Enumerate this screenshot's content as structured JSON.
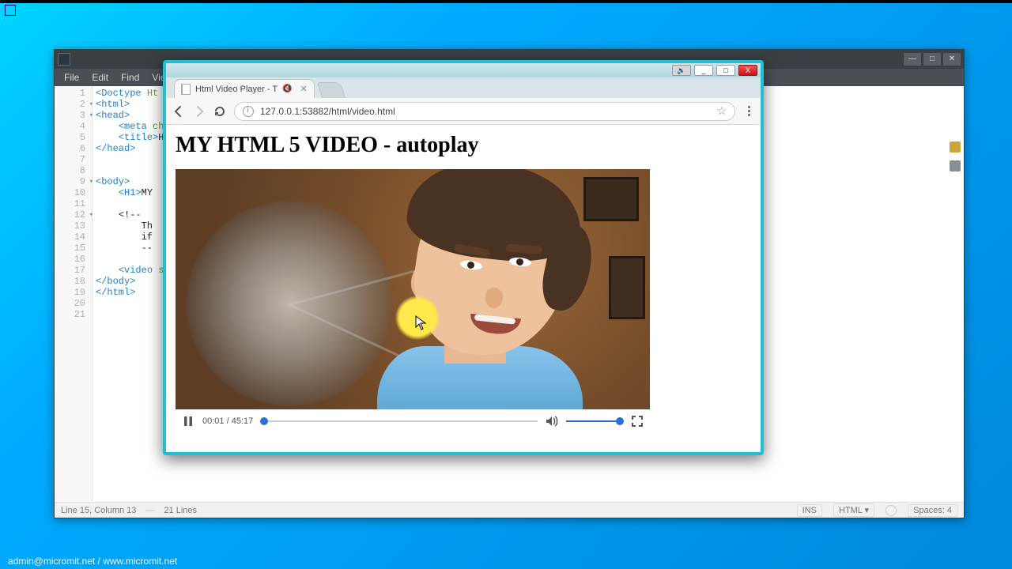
{
  "editor": {
    "menus": [
      "File",
      "Edit",
      "Find",
      "View"
    ],
    "lines": {
      "total": 21,
      "code": [
        {
          "n": 1,
          "html": "<span class='tag'>&lt;Doctype</span> <span class='attr'>Ht</span>"
        },
        {
          "n": 2,
          "fold": true,
          "html": "<span class='tag'>&lt;html&gt;</span>"
        },
        {
          "n": 3,
          "fold": true,
          "html": "<span class='tag'>&lt;head&gt;</span>"
        },
        {
          "n": 4,
          "html": "    <span class='tag'>&lt;meta</span> <span class='attr'>cha</span>"
        },
        {
          "n": 5,
          "html": "    <span class='tag'>&lt;title&gt;</span><span class='txt'>Ht</span>"
        },
        {
          "n": 6,
          "html": "<span class='tag'>&lt;/head&gt;</span>"
        },
        {
          "n": 7,
          "html": ""
        },
        {
          "n": 8,
          "html": ""
        },
        {
          "n": 9,
          "fold": true,
          "html": "<span class='tag'>&lt;body&gt;</span>"
        },
        {
          "n": 10,
          "html": "    <span class='tag'>&lt;H1&gt;</span><span class='txt'>MY</span>"
        },
        {
          "n": 11,
          "html": ""
        },
        {
          "n": 12,
          "fold": true,
          "html": "    <span class='txt'>&lt;!--</span>"
        },
        {
          "n": 13,
          "html": "        <span class='txt'>Th</span>"
        },
        {
          "n": 14,
          "html": "        <span class='txt'>if</span>"
        },
        {
          "n": 15,
          "html": "        <span class='txt'>--</span>"
        },
        {
          "n": 16,
          "html": ""
        },
        {
          "n": 17,
          "html": "    <span class='tag'>&lt;video</span> <span class='attr'>s</span>"
        },
        {
          "n": 18,
          "html": "<span class='tag'>&lt;/body&gt;</span>"
        },
        {
          "n": 19,
          "html": "<span class='tag'>&lt;/html&gt;</span>"
        },
        {
          "n": 20,
          "html": ""
        },
        {
          "n": 21,
          "html": ""
        }
      ]
    },
    "status": {
      "pos": "Line 15, Column 13",
      "lines": "21 Lines",
      "ins": "INS",
      "lang": "HTML",
      "spaces": "Spaces: 4"
    },
    "winctrls": {
      "min": "—",
      "max": "□",
      "close": "✕"
    }
  },
  "browser": {
    "winbuttons": {
      "mute": "🔇",
      "min": "_",
      "max": "□",
      "close": "X"
    },
    "tab": {
      "title": "Html Video Player - T",
      "muted": true
    },
    "nav": {
      "back": "",
      "forward": "",
      "reload": ""
    },
    "url": "127.0.0.1:53882/html/video.html",
    "page": {
      "heading": "MY HTML 5 VIDEO - autoplay"
    },
    "player": {
      "state": "playing",
      "current": "00:01",
      "duration": "45:17",
      "seek_pct": 1,
      "volume_pct": 95
    }
  },
  "footer": "admin@micromit.net / www.micromit.net"
}
